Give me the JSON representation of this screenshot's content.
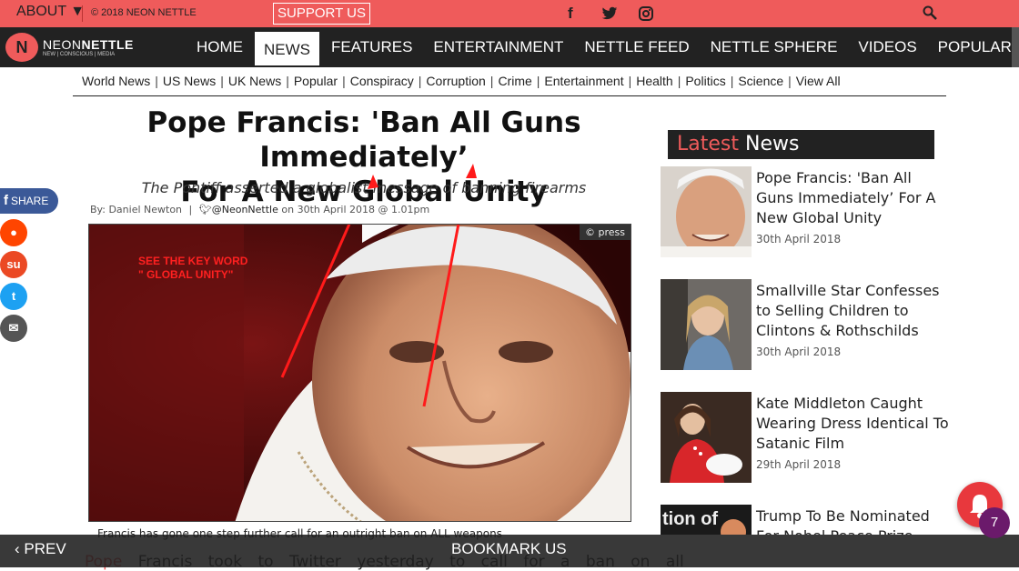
{
  "topbar": {
    "about": "ABOUT ▼",
    "copyright": "© 2018 NEON NETTLE",
    "support": "SUPPORT US",
    "social_icons": [
      "facebook-icon",
      "twitter-icon",
      "instagram-icon"
    ],
    "search_icon": "search-icon"
  },
  "logo": {
    "mark": "N",
    "name_light": "NEON",
    "name_bold": "NETTLE",
    "tagline": "NEW | CONSCIOUS | MEDIA"
  },
  "nav": {
    "items": [
      "HOME",
      "NEWS",
      "FEATURES",
      "ENTERTAINMENT",
      "NETTLE FEED",
      "NETTLE SPHERE",
      "VIDEOS",
      "POPULAR"
    ],
    "active": "NEWS"
  },
  "subnav": [
    "World News",
    "US News",
    "UK News",
    "Popular",
    "Conspiracy",
    "Corruption",
    "Crime",
    "Entertainment",
    "Health",
    "Politics",
    "Science",
    "View All"
  ],
  "article": {
    "title_line1": "Pope Francis: 'Ban All Guns Immediately’",
    "title_line2": "For A New Global Unity",
    "subtitle": "The Pontiff asserted a globalist message of banning firearms",
    "author": "By: Daniel Newton",
    "handle": "@NeonNettle",
    "date": "on 30th April 2018 @ 1.01pm",
    "photo_credit": "© press",
    "photo_annotation": "SEE THE KEY WORD\n\" GLOBAL UNITY\"",
    "caption": "Francis has gone one step further call for an outright ban on ALL weapons",
    "body_first_word": "Pope",
    "body_rest": "Francis took to Twitter yesterday to call for a ban on all"
  },
  "share": {
    "facebook": "SHARE",
    "icons": [
      "reddit-icon",
      "stumbleupon-icon",
      "twitter-icon",
      "email-icon"
    ]
  },
  "sidebar": {
    "heading_accent": "Latest",
    "heading_rest": "News",
    "items": [
      {
        "title": "Pope Francis: 'Ban All Guns Immediately’ For A New Global Unity",
        "date": "30th April 2018"
      },
      {
        "title": "Smallville Star Confesses to Selling Children to Clintons & Rothschilds",
        "date": "30th April 2018"
      },
      {
        "title": "Kate Middleton Caught Wearing Dress Identical To Satanic Film",
        "date": "29th April 2018"
      },
      {
        "title": "Trump To Be Nominated For Nobel Peace Prize Amid Historic North",
        "date": "",
        "thumb_text": "tion of"
      }
    ]
  },
  "bottombar": {
    "prev": "‹ PREV",
    "bookmark": "BOOKMARK US"
  },
  "notifications": {
    "count": "7"
  },
  "colors": {
    "accent": "#ef5b5b",
    "dark": "#222222",
    "facebook": "#3b5998",
    "reddit": "#ff4500",
    "stumbleupon": "#eb4924",
    "twitter": "#1da1f2",
    "email": "#555555"
  }
}
